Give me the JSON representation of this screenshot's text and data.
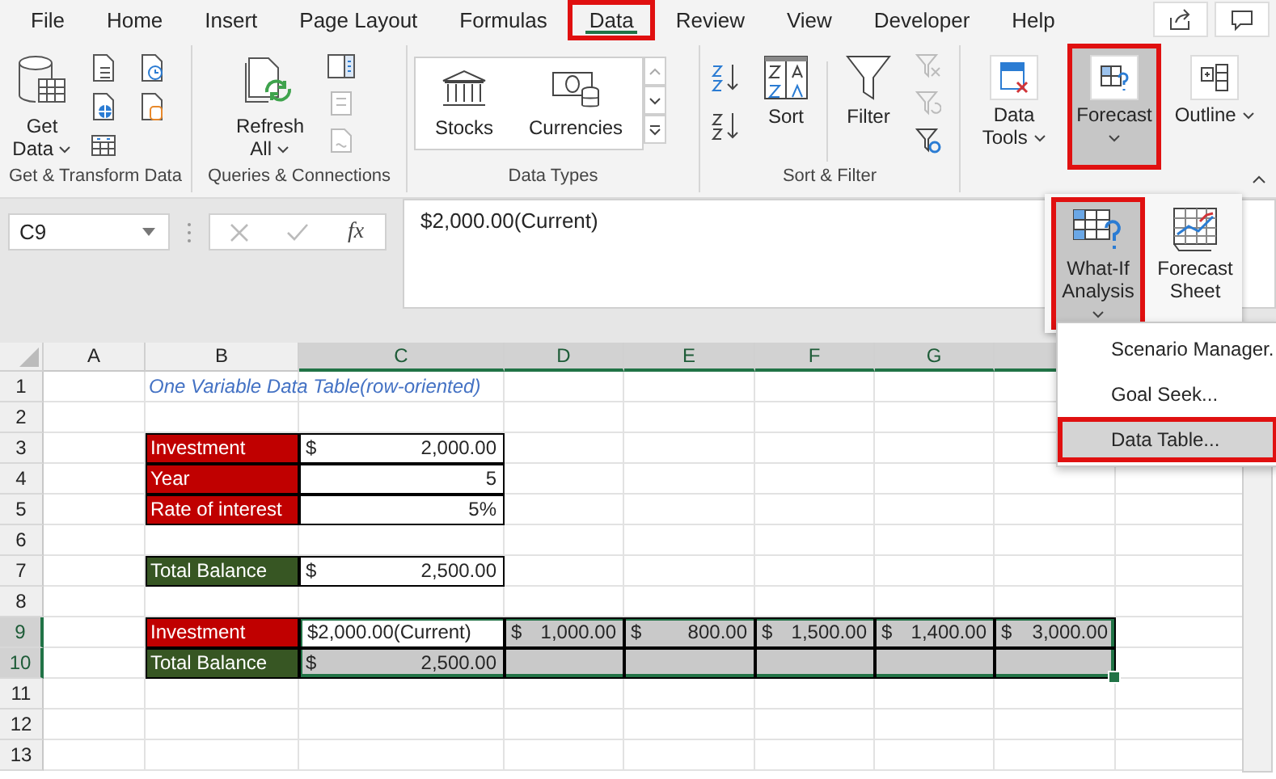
{
  "tabs": [
    {
      "label": "File",
      "selected": false,
      "highlighted": false
    },
    {
      "label": "Home",
      "selected": false,
      "highlighted": false
    },
    {
      "label": "Insert",
      "selected": false,
      "highlighted": false
    },
    {
      "label": "Page Layout",
      "selected": false,
      "highlighted": false
    },
    {
      "label": "Formulas",
      "selected": false,
      "highlighted": false
    },
    {
      "label": "Data",
      "selected": true,
      "highlighted": true
    },
    {
      "label": "Review",
      "selected": false,
      "highlighted": false
    },
    {
      "label": "View",
      "selected": false,
      "highlighted": false
    },
    {
      "label": "Developer",
      "selected": false,
      "highlighted": false
    },
    {
      "label": "Help",
      "selected": false,
      "highlighted": false
    }
  ],
  "ribbon": {
    "groups": [
      {
        "label": "Get & Transform Data",
        "buttons": [
          {
            "label": "Get Data",
            "dropdown": true
          }
        ]
      },
      {
        "label": "Queries & Connections",
        "buttons": [
          {
            "label": "Refresh All",
            "dropdown": true
          }
        ]
      },
      {
        "label": "Data Types",
        "gallery": [
          "Stocks",
          "Currencies"
        ]
      },
      {
        "label": "Sort & Filter",
        "buttons": [
          {
            "label": "Sort"
          },
          {
            "label": "Filter"
          }
        ]
      },
      {
        "buttons": [
          {
            "label": "Data Tools",
            "dropdown": true,
            "selected": false,
            "highlighted": false
          },
          {
            "label": "Forecast",
            "dropdown": true,
            "selected": true,
            "highlighted": true
          },
          {
            "label": "Outline",
            "dropdown": true,
            "selected": false,
            "highlighted": false
          }
        ]
      }
    ]
  },
  "formula_bar": {
    "name_box": "C9",
    "function_label": "fx",
    "formula": "$2,000.00(Current)"
  },
  "sheet": {
    "columns": [
      {
        "label": "A",
        "selected": false
      },
      {
        "label": "B",
        "selected": false
      },
      {
        "label": "C",
        "selected": true
      },
      {
        "label": "D",
        "selected": true
      },
      {
        "label": "E",
        "selected": true
      },
      {
        "label": "F",
        "selected": true
      },
      {
        "label": "G",
        "selected": true
      },
      {
        "selected": true
      }
    ],
    "rows": [
      {
        "number": "1",
        "selected": false,
        "cells": [
          {
            "kind": "empty"
          },
          {
            "kind": "title",
            "text": "One Variable Data Table(row-oriented)"
          }
        ]
      },
      {
        "number": "2",
        "selected": false
      },
      {
        "number": "3",
        "selected": false,
        "cells": [
          {
            "kind": "empty"
          },
          {
            "kind": "label",
            "text": "Investment",
            "color": "#c00000"
          },
          {
            "kind": "value",
            "currency": "$",
            "text": "2,000.00"
          }
        ]
      },
      {
        "number": "4",
        "selected": false,
        "cells": [
          {
            "kind": "empty"
          },
          {
            "kind": "label",
            "text": "Year",
            "color": "#c00000"
          },
          {
            "kind": "value",
            "text": "5"
          }
        ]
      },
      {
        "number": "5",
        "selected": false,
        "cells": [
          {
            "kind": "empty"
          },
          {
            "kind": "label",
            "text": "Rate of interest",
            "color": "#c00000"
          },
          {
            "kind": "value",
            "text": "5%"
          }
        ]
      },
      {
        "number": "6",
        "selected": false
      },
      {
        "number": "7",
        "selected": false,
        "cells": [
          {
            "kind": "empty"
          },
          {
            "kind": "label",
            "text": "Total Balance",
            "color": "#375623"
          },
          {
            "kind": "value",
            "currency": "$",
            "text": "2,500.00"
          }
        ]
      },
      {
        "number": "8",
        "selected": false
      },
      {
        "number": "9",
        "selected": true,
        "cells": [
          {
            "kind": "empty"
          },
          {
            "kind": "label",
            "text": "Investment",
            "color": "#c00000"
          },
          {
            "kind": "text",
            "text": "$2,000.00(Current)",
            "selected": true,
            "active": true
          },
          {
            "kind": "value",
            "currency": "$",
            "text": "1,000.00",
            "selected": true
          },
          {
            "kind": "value",
            "currency": "$",
            "text": "800.00",
            "selected": true
          },
          {
            "kind": "value",
            "currency": "$",
            "text": "1,500.00",
            "selected": true
          },
          {
            "kind": "value",
            "currency": "$",
            "text": "1,400.00",
            "selected": true
          },
          {
            "kind": "value",
            "currency": "$",
            "text": "3,000.00",
            "selected": true
          }
        ]
      },
      {
        "number": "10",
        "selected": true,
        "cells": [
          {
            "kind": "empty"
          },
          {
            "kind": "label",
            "text": "Total Balance",
            "color": "#375623"
          },
          {
            "kind": "value",
            "currency": "$",
            "text": "2,500.00",
            "selected": true
          },
          {
            "kind": "value",
            "selected": true
          },
          {
            "kind": "value",
            "selected": true
          },
          {
            "kind": "value",
            "selected": true
          },
          {
            "kind": "value",
            "selected": true
          },
          {
            "kind": "value",
            "selected": true
          }
        ]
      },
      {
        "number": "11",
        "selected": false
      },
      {
        "number": "12",
        "selected": false
      },
      {
        "number": "13",
        "selected": false
      }
    ]
  },
  "forecast_menu": {
    "buttons": [
      {
        "label": "What-If Analysis",
        "dropdown": true,
        "selected": true,
        "highlighted": true
      },
      {
        "label": "Forecast Sheet",
        "selected": false,
        "highlighted": false
      }
    ],
    "items": [
      {
        "label": "Scenario Manager.",
        "selected": false,
        "highlighted": false
      },
      {
        "label": "Goal Seek...",
        "selected": false,
        "highlighted": false
      },
      {
        "label": "Data Table...",
        "selected": true,
        "highlighted": true
      }
    ]
  }
}
